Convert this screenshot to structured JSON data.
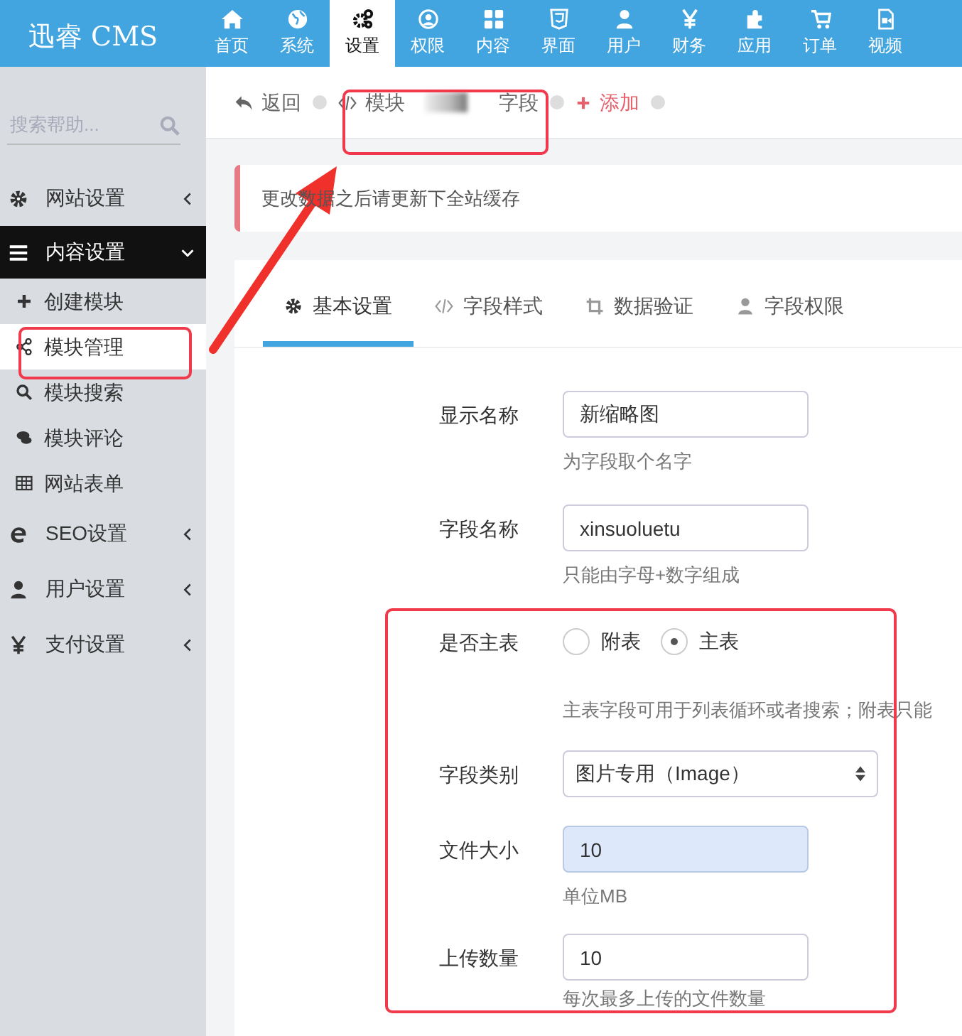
{
  "app": {
    "logo": "迅睿 CMS"
  },
  "top_nav": [
    {
      "label": "首页",
      "selected": false
    },
    {
      "label": "系统",
      "selected": false
    },
    {
      "label": "设置",
      "selected": true
    },
    {
      "label": "权限",
      "selected": false
    },
    {
      "label": "内容",
      "selected": false
    },
    {
      "label": "界面",
      "selected": false
    },
    {
      "label": "用户",
      "selected": false
    },
    {
      "label": "财务",
      "selected": false
    },
    {
      "label": "应用",
      "selected": false
    },
    {
      "label": "订单",
      "selected": false
    },
    {
      "label": "视频",
      "selected": false
    }
  ],
  "sidebar": {
    "search": {
      "placeholder": "搜索帮助..."
    },
    "items": [
      {
        "label": "网站设置",
        "expanded": false
      },
      {
        "label": "内容设置",
        "expanded": true,
        "children": [
          {
            "label": "创建模块",
            "selected": false
          },
          {
            "label": "模块管理",
            "selected": true
          },
          {
            "label": "模块搜索",
            "selected": false
          },
          {
            "label": "模块评论",
            "selected": false
          },
          {
            "label": "网站表单",
            "selected": false
          }
        ]
      },
      {
        "label": "SEO设置",
        "expanded": false
      },
      {
        "label": "用户设置",
        "expanded": false
      },
      {
        "label": "支付设置",
        "expanded": false
      }
    ]
  },
  "breadcrumb": [
    {
      "kind": "back",
      "label": "返回"
    },
    {
      "kind": "code",
      "label": "模块"
    },
    {
      "kind": "blurred"
    },
    {
      "kind": "plain",
      "label": "字段"
    },
    {
      "kind": "add",
      "label": "添加"
    }
  ],
  "alert": {
    "text": "更改数据之后请更新下全站缓存"
  },
  "tabs": [
    {
      "label": "基本设置",
      "selected": true
    },
    {
      "label": "字段样式",
      "selected": false
    },
    {
      "label": "数据验证",
      "selected": false
    },
    {
      "label": "字段权限",
      "selected": false
    }
  ],
  "form": [
    {
      "kind": "input",
      "label": "显示名称",
      "value": "新缩略图",
      "autofilled": false,
      "help": "为字段取个名字"
    },
    {
      "kind": "input",
      "label": "字段名称",
      "value": "xinsuoluetu",
      "autofilled": false,
      "help": "只能由字母+数字组成"
    },
    {
      "kind": "radio",
      "label": "是否主表",
      "options": [
        {
          "label": "附表",
          "selected": false
        },
        {
          "label": "主表",
          "selected": true
        }
      ],
      "help": "主表字段可用于列表循环或者搜索；附表只能"
    },
    {
      "kind": "select",
      "label": "字段类别",
      "value": "图片专用（Image）"
    },
    {
      "kind": "input",
      "label": "文件大小",
      "value": "10",
      "autofilled": true,
      "help": "单位MB"
    },
    {
      "kind": "input",
      "label": "上传数量",
      "value": "10",
      "autofilled": false,
      "help": "每次最多上传的文件数量"
    }
  ]
}
